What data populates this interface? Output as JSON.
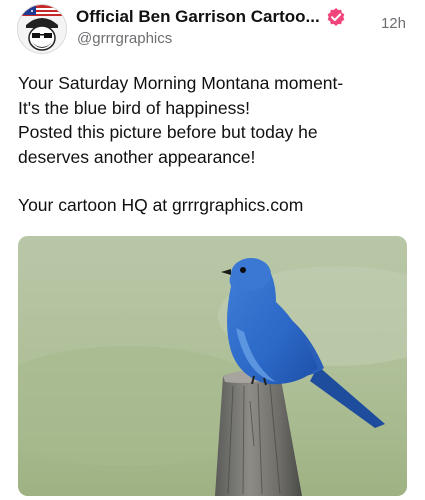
{
  "post": {
    "author_name": "Official  Ben Garrison Cartoo...",
    "handle": "@grrrgraphics",
    "timestamp": "12h",
    "text_lines": [
      "Your Saturday Morning Montana moment-",
      "It's the blue bird of happiness!",
      "Posted this picture before but today he",
      "deserves another appearance!"
    ],
    "link_line": "Your cartoon HQ at grrrgraphics.com",
    "icons": {
      "avatar": "avatar-cartoon-face",
      "verified": "verified-badge-icon"
    },
    "colors": {
      "verified_badge": "#f0457a",
      "secondary_text": "#6e6e73"
    },
    "media": {
      "image": "photo-mountain-bluebird-on-fence-post"
    }
  }
}
